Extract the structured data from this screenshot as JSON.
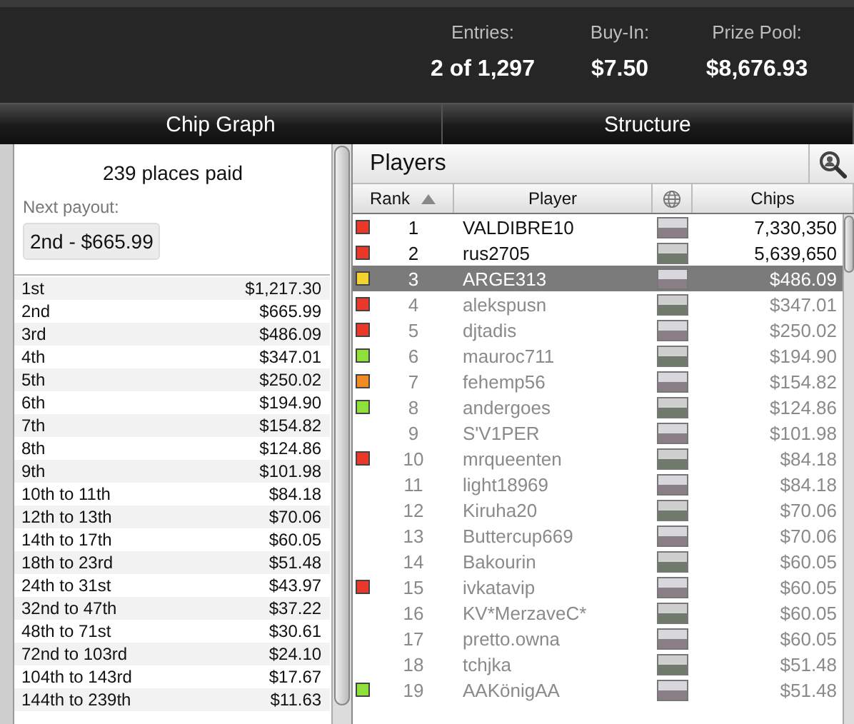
{
  "stats": [
    {
      "label": "Entries:",
      "value": "2 of 1,297"
    },
    {
      "label": "Buy-In:",
      "value": "$7.50"
    },
    {
      "label": "Prize Pool:",
      "value": "$8,676.93"
    }
  ],
  "tabs": [
    {
      "label": "Chip Graph",
      "selected": false
    },
    {
      "label": "Structure",
      "selected": false
    }
  ],
  "payouts": {
    "places_paid": "239 places paid",
    "next_label": "Next payout:",
    "next_value": "2nd - $665.99",
    "rows": [
      {
        "place": "1st",
        "amount": "$1,217.30"
      },
      {
        "place": "2nd",
        "amount": "$665.99"
      },
      {
        "place": "3rd",
        "amount": "$486.09"
      },
      {
        "place": "4th",
        "amount": "$347.01"
      },
      {
        "place": "5th",
        "amount": "$250.02"
      },
      {
        "place": "6th",
        "amount": "$194.90"
      },
      {
        "place": "7th",
        "amount": "$154.82"
      },
      {
        "place": "8th",
        "amount": "$124.86"
      },
      {
        "place": "9th",
        "amount": "$101.98"
      },
      {
        "place": "10th to 11th",
        "amount": "$84.18"
      },
      {
        "place": "12th to 13th",
        "amount": "$70.06"
      },
      {
        "place": "14th to 17th",
        "amount": "$60.05"
      },
      {
        "place": "18th to 23rd",
        "amount": "$51.48"
      },
      {
        "place": "24th to 31st",
        "amount": "$43.97"
      },
      {
        "place": "32nd to 47th",
        "amount": "$37.22"
      },
      {
        "place": "48th to 71st",
        "amount": "$30.61"
      },
      {
        "place": "72nd to 103rd",
        "amount": "$24.10"
      },
      {
        "place": "104th to 143rd",
        "amount": "$17.67"
      },
      {
        "place": "144th to 239th",
        "amount": "$11.63"
      }
    ]
  },
  "players": {
    "title": "Players",
    "columns": [
      "Rank",
      "Player",
      "Chips"
    ],
    "rows": [
      {
        "rank": "1",
        "name": "VALDIBRE10",
        "chips": "7,330,350",
        "color": "#e8382c",
        "busted": false,
        "selected": false
      },
      {
        "rank": "2",
        "name": "rus2705",
        "chips": "5,639,650",
        "color": "#e8382c",
        "busted": false,
        "selected": false
      },
      {
        "rank": "3",
        "name": "ARGE313",
        "chips": "$486.09",
        "color": "#f2d22e",
        "busted": true,
        "selected": true
      },
      {
        "rank": "4",
        "name": "alekspusn",
        "chips": "$347.01",
        "color": "#e8382c",
        "busted": true,
        "selected": false
      },
      {
        "rank": "5",
        "name": "djtadis",
        "chips": "$250.02",
        "color": "#e8382c",
        "busted": true,
        "selected": false
      },
      {
        "rank": "6",
        "name": "mauroc711",
        "chips": "$194.90",
        "color": "#8fe03a",
        "busted": true,
        "selected": false
      },
      {
        "rank": "7",
        "name": "fehemp56",
        "chips": "$154.82",
        "color": "#f08a24",
        "busted": true,
        "selected": false
      },
      {
        "rank": "8",
        "name": "andergoes",
        "chips": "$124.86",
        "color": "#8fe03a",
        "busted": true,
        "selected": false
      },
      {
        "rank": "9",
        "name": "S'V1PER",
        "chips": "$101.98",
        "busted": true,
        "selected": false
      },
      {
        "rank": "10",
        "name": "mrqueenten",
        "chips": "$84.18",
        "color": "#e8382c",
        "busted": true,
        "selected": false
      },
      {
        "rank": "11",
        "name": "light18969",
        "chips": "$84.18",
        "busted": true,
        "selected": false
      },
      {
        "rank": "12",
        "name": "Kiruha20",
        "chips": "$70.06",
        "busted": true,
        "selected": false
      },
      {
        "rank": "13",
        "name": "Buttercup669",
        "chips": "$70.06",
        "busted": true,
        "selected": false
      },
      {
        "rank": "14",
        "name": "Bakourin",
        "chips": "$60.05",
        "busted": true,
        "selected": false
      },
      {
        "rank": "15",
        "name": "ivkatavip",
        "chips": "$60.05",
        "color": "#e8382c",
        "busted": true,
        "selected": false
      },
      {
        "rank": "16",
        "name": "KV*MerzaveC*",
        "chips": "$60.05",
        "busted": true,
        "selected": false
      },
      {
        "rank": "17",
        "name": "pretto.owna",
        "chips": "$60.05",
        "busted": true,
        "selected": false
      },
      {
        "rank": "18",
        "name": "tchjka",
        "chips": "$51.48",
        "busted": true,
        "selected": false
      },
      {
        "rank": "19",
        "name": "AAKönigAA",
        "chips": "$51.48",
        "color": "#8fe03a",
        "busted": true,
        "selected": false
      }
    ]
  }
}
